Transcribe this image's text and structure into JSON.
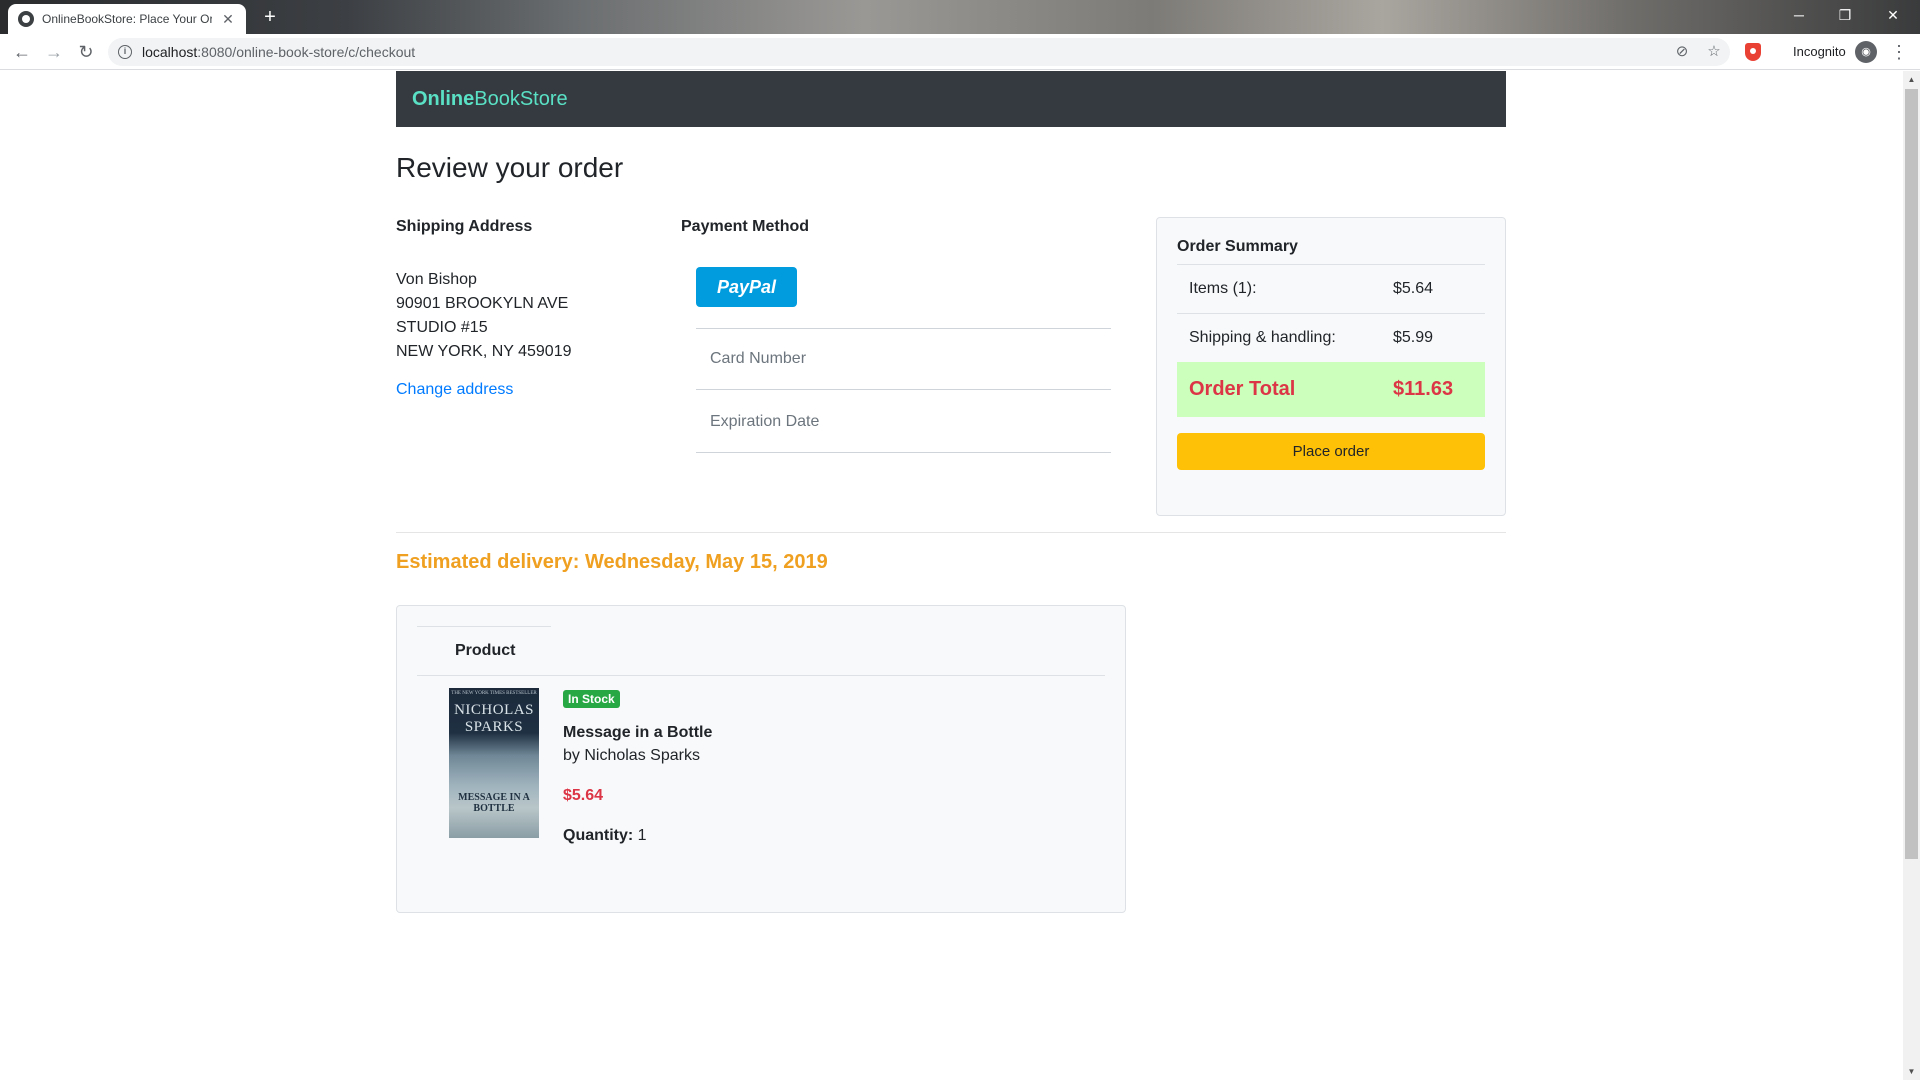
{
  "browser": {
    "tab_title": "OnlineBookStore: Place Your Order",
    "url_host": "localhost",
    "url_rest": ":8080/online-book-store/c/checkout",
    "incognito_label": "Incognito"
  },
  "navbar": {
    "brand_bold": "Online",
    "brand_rest": "BookStore"
  },
  "page": {
    "title": "Review your order"
  },
  "shipping": {
    "label": "Shipping Address",
    "lines": [
      "Von Bishop",
      "90901 BROOKYLN AVE",
      "STUDIO #15",
      "NEW YORK, NY 459019"
    ],
    "change_link": "Change address"
  },
  "payment": {
    "label": "Payment Method",
    "paypal_label": "PayPal",
    "card_number_placeholder": "Card Number",
    "expiration_placeholder": "Expiration Date"
  },
  "summary": {
    "title": "Order Summary",
    "items_label": "Items (1):",
    "items_value": "$5.64",
    "shipping_label": "Shipping & handling:",
    "shipping_value": "$5.99",
    "total_label": "Order Total",
    "total_value": "$11.63",
    "place_order": "Place order"
  },
  "delivery": {
    "text": "Estimated delivery: Wednesday, May 15, 2019"
  },
  "product_table": {
    "header": "Product",
    "item": {
      "stock_badge": "In Stock",
      "title": "Message in a Bottle",
      "author": "by Nicholas Sparks",
      "price": "$5.64",
      "quantity_label": "Quantity:",
      "quantity_value": "1",
      "cover_tagline": "THE NEW YORK TIMES BESTSELLER",
      "cover_author": "NICHOLAS SPARKS",
      "cover_title": "MESSAGE IN A BOTTLE"
    }
  },
  "colors": {
    "navbar_bg": "#343a40",
    "brand": "#5ae0c4",
    "link": "#007bff",
    "price_red": "#dc3545",
    "delivery_orange": "#f0a020",
    "total_bg": "#ccffbb",
    "place_order_bg": "#ffc107",
    "paypal_bg": "#009cde",
    "in_stock_green": "#28a745"
  }
}
